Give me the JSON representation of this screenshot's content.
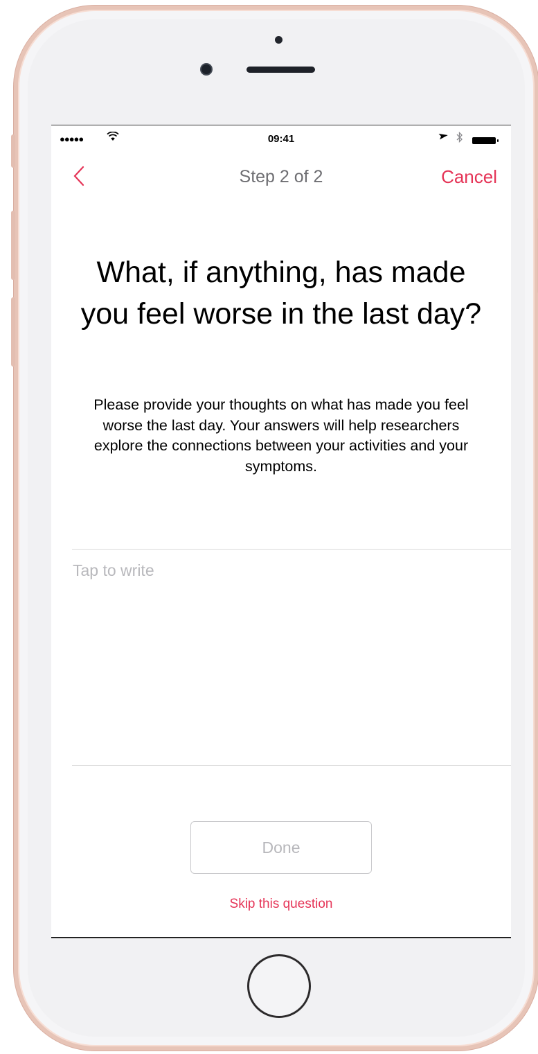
{
  "device": {
    "frame_color": "#e7c4b7"
  },
  "status_bar": {
    "signal": "●●●●●",
    "time": "09:41"
  },
  "nav_bar": {
    "title": "Step 2 of 2",
    "cancel_label": "Cancel",
    "accent_color": "#e53457"
  },
  "question": {
    "title": "What, if anything, has made you feel worse in the last day?",
    "description": "Please provide your thoughts on what has made you feel worse the last day.  Your answers will help researchers explore the connections between your activities and your symptoms."
  },
  "answer": {
    "placeholder": "Tap to write",
    "value": ""
  },
  "actions": {
    "done_label": "Done",
    "skip_label": "Skip this question"
  }
}
